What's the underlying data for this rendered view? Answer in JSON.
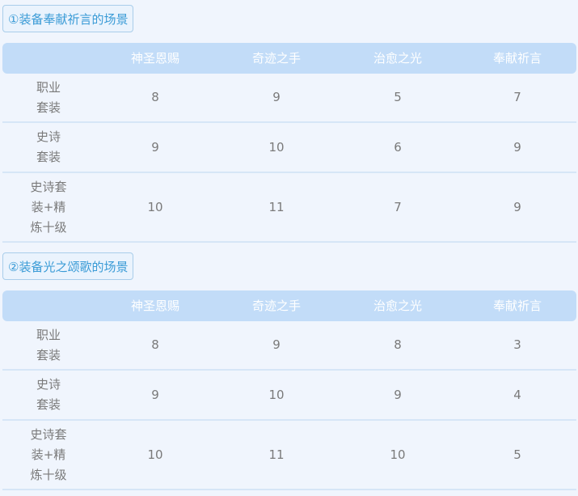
{
  "sections": [
    {
      "title": "①装备奉献祈言的场景",
      "headers": [
        "",
        "神圣恩赐",
        "奇迹之手",
        "治愈之光",
        "奉献祈言"
      ],
      "rows": [
        {
          "label_lines": [
            "职业",
            "套装"
          ],
          "values": [
            "8",
            "9",
            "5",
            "7"
          ]
        },
        {
          "label_lines": [
            "史诗",
            "套装"
          ],
          "values": [
            "9",
            "10",
            "6",
            "9"
          ]
        },
        {
          "label_lines": [
            "史诗套",
            "装+精",
            "炼十级"
          ],
          "values": [
            "10",
            "11",
            "7",
            "9"
          ]
        }
      ]
    },
    {
      "title": "②装备光之颂歌的场景",
      "headers": [
        "",
        "神圣恩赐",
        "奇迹之手",
        "治愈之光",
        "奉献祈言"
      ],
      "rows": [
        {
          "label_lines": [
            "职业",
            "套装"
          ],
          "values": [
            "8",
            "9",
            "8",
            "3"
          ]
        },
        {
          "label_lines": [
            "史诗",
            "套装"
          ],
          "values": [
            "9",
            "10",
            "9",
            "4"
          ]
        },
        {
          "label_lines": [
            "史诗套",
            "装+精",
            "炼十级"
          ],
          "values": [
            "10",
            "11",
            "10",
            "5"
          ]
        }
      ]
    }
  ]
}
